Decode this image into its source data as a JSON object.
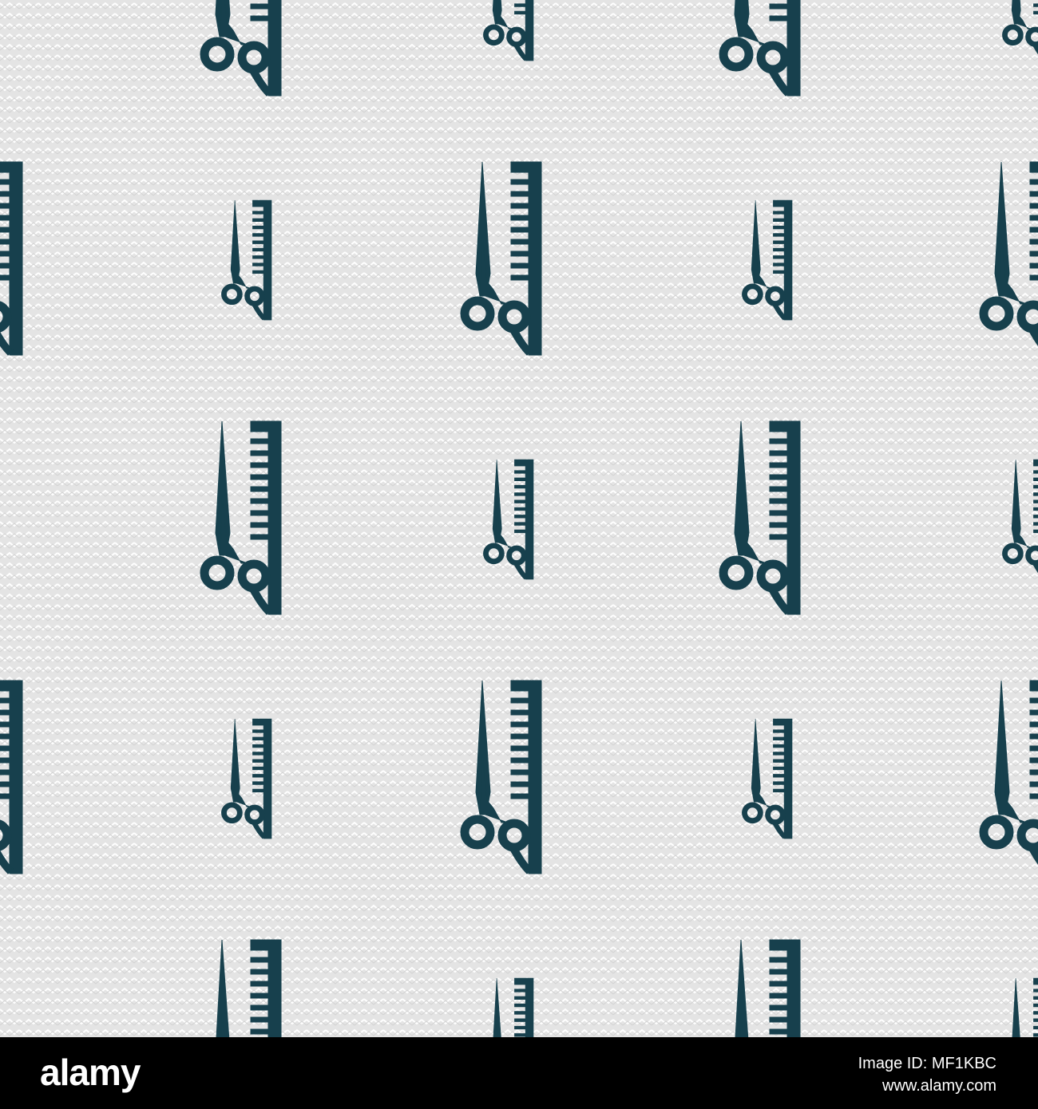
{
  "background": {
    "base_color": "#e4e4e4",
    "wave_color": "#ffffff",
    "pattern": "zigzag-lines"
  },
  "icon": {
    "name": "scissors-and-comb-icon",
    "color": "#17404d"
  },
  "footer": {
    "brand": "alamy",
    "image_id": "Image ID: MF1KBC",
    "site_url": "www.alamy.com",
    "background_color": "#000000",
    "text_color": "#ffffff"
  }
}
